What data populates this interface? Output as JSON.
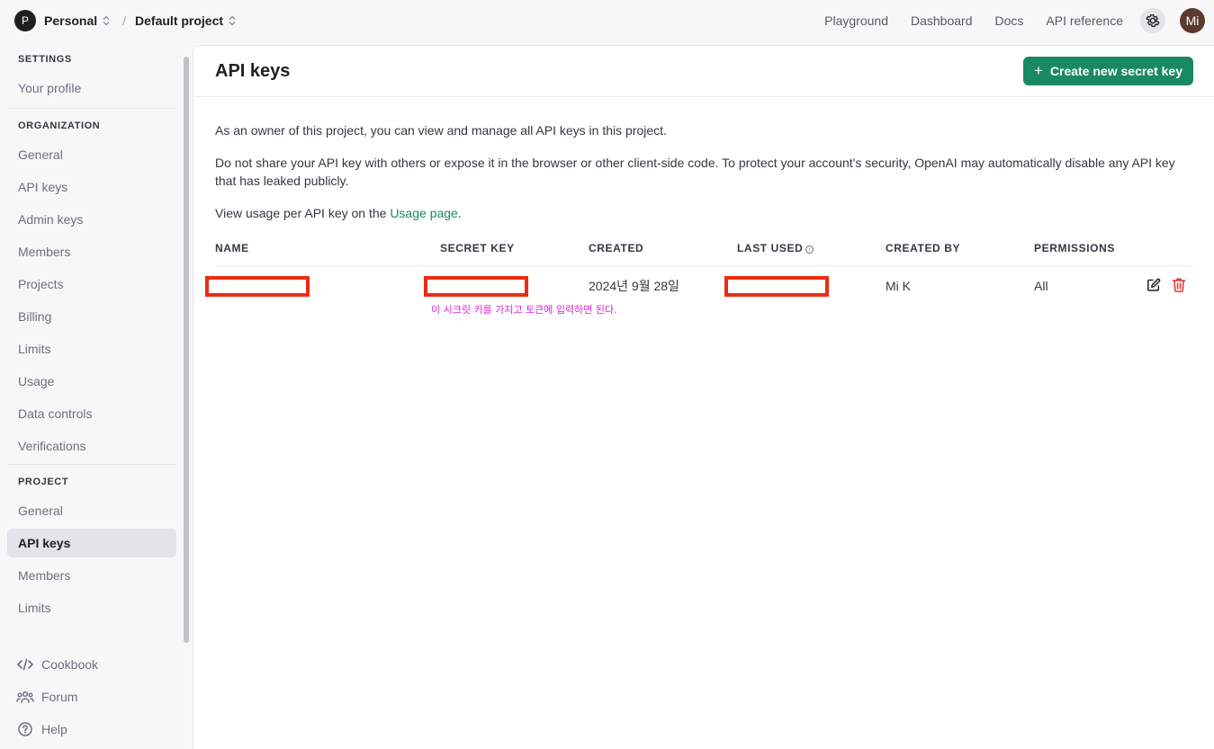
{
  "topbar": {
    "org_initial": "P",
    "org_name": "Personal",
    "project_name": "Default project",
    "nav": [
      "Playground",
      "Dashboard",
      "Docs",
      "API reference"
    ],
    "user_initials": "Mi"
  },
  "sidebar": {
    "settings_label": "SETTINGS",
    "settings_items": [
      "Your profile"
    ],
    "organization_label": "ORGANIZATION",
    "organization_items": [
      "General",
      "API keys",
      "Admin keys",
      "Members",
      "Projects",
      "Billing",
      "Limits",
      "Usage",
      "Data controls",
      "Verifications"
    ],
    "project_label": "PROJECT",
    "project_items": [
      "General",
      "API keys",
      "Members",
      "Limits"
    ],
    "active_item": "API keys",
    "bottom_links": [
      {
        "label": "Cookbook",
        "icon": "code-icon"
      },
      {
        "label": "Forum",
        "icon": "people-icon"
      },
      {
        "label": "Help",
        "icon": "help-icon"
      }
    ]
  },
  "main": {
    "title": "API keys",
    "create_button": "Create new secret key",
    "para1": "As an owner of this project, you can view and manage all API keys in this project.",
    "para2": "Do not share your API key with others or expose it in the browser or other client-side code. To protect your account's security, OpenAI may automatically disable any API key that has leaked publicly.",
    "para3_prefix": "View usage per API key on the ",
    "para3_link": "Usage page",
    "para3_suffix": "."
  },
  "table": {
    "headers": [
      "NAME",
      "SECRET KEY",
      "CREATED",
      "LAST USED",
      "CREATED BY",
      "PERMISSIONS"
    ],
    "rows": [
      {
        "name": "",
        "secret_key": "",
        "created": "2024년 9월 28일",
        "last_used": "",
        "created_by": "Mi K",
        "permissions": "All"
      }
    ]
  },
  "annotation": "이 시크릿 키를 가지고 토큰에 입력하면 된다.",
  "colors": {
    "accent": "#198964",
    "redaction": "#ec2c12",
    "annotation": "#e020d8",
    "delete": "#d9342b"
  }
}
